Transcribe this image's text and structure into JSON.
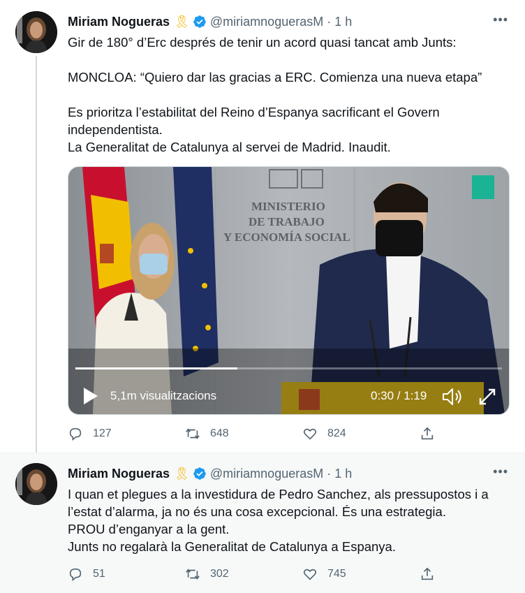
{
  "tweets": [
    {
      "name": "Miriam Nogueras",
      "ribbon": "🎗",
      "handle": "@miriamnoguerasM",
      "dot": "·",
      "time": "1 h",
      "more": "•••",
      "lines": [
        "Gir de 180° d’Erc després de tenir un acord quasi tancat amb Junts:",
        "",
        "MONCLOA: “Quiero dar las gracias a ERC. Comienza una nueva etapa”",
        "",
        "Es prioritza l’estabilitat del Reino d’Espanya sacrificant el Govern",
        "independentista.",
        "La Generalitat de Catalunya al servei de Madrid. Inaudit."
      ],
      "video": {
        "views": "5,1m visualitzacions",
        "time": "0:30 / 1:19",
        "progress": 0.38,
        "sign": [
          "MINISTERIO",
          "DE TRABAJO",
          "Y ECONOMÍA SOCIAL"
        ]
      },
      "replies": "127",
      "retweets": "648",
      "likes": "824"
    },
    {
      "name": "Miriam Nogueras",
      "ribbon": "🎗",
      "handle": "@miriamnoguerasM",
      "dot": "·",
      "time": "1 h",
      "more": "•••",
      "lines": [
        "I quan et plegues a la investidura de Pedro Sanchez, als pressupostos i a",
        "l’estat d’alarma, ja no és una cosa excepcional. És una estrategia.",
        "PROU d’enganyar a la gent.",
        "Junts no regalarà la Generalitat de Catalunya a Espanya."
      ],
      "replies": "51",
      "retweets": "302",
      "likes": "745"
    }
  ],
  "colors": {
    "verified": "#1d9bf0",
    "secondary": "#536471",
    "thread_line": "#cfd9de"
  },
  "icons": [
    "reply-icon",
    "retweet-icon",
    "like-icon",
    "share-icon",
    "verified-badge-icon",
    "play-icon",
    "volume-icon",
    "fullscreen-icon"
  ]
}
